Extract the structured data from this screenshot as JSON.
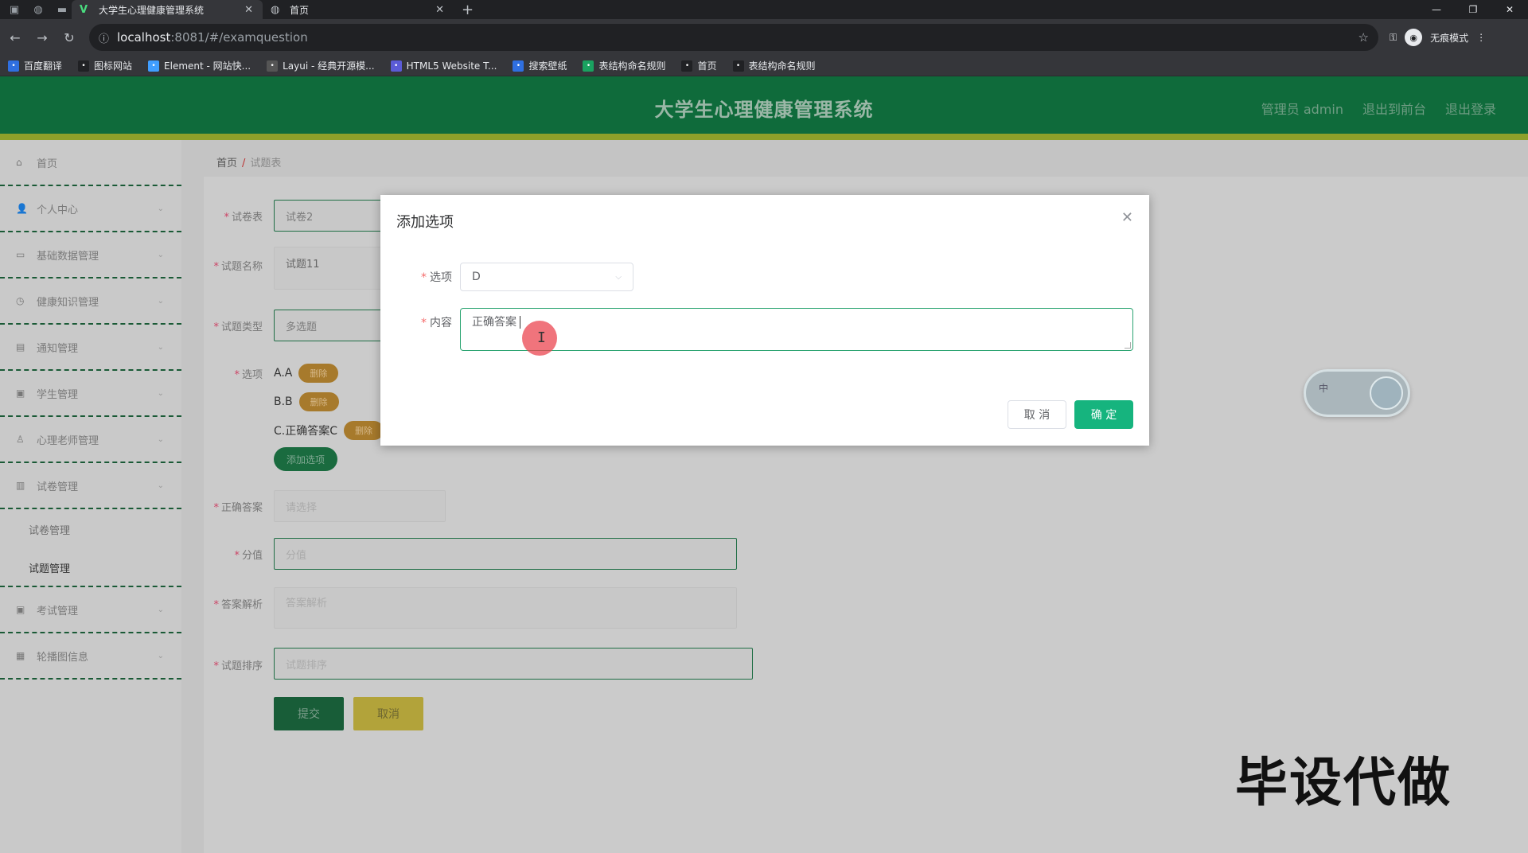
{
  "browser": {
    "tabs": [
      {
        "title": "大学生心理健康管理系统",
        "active": true
      },
      {
        "title": "首页",
        "active": false
      }
    ],
    "url_host": "localhost",
    "url_path": ":8081/#/examquestion",
    "incognito_label": "无痕模式",
    "bookmarks": [
      {
        "label": "百度翻译",
        "color": "#2f6fe0"
      },
      {
        "label": "图标网站",
        "color": "#202124"
      },
      {
        "label": "Element - 网站快...",
        "color": "#409eff"
      },
      {
        "label": "Layui - 经典开源模...",
        "color": "#555"
      },
      {
        "label": "HTML5 Website T...",
        "color": "#5b5bd6"
      },
      {
        "label": "搜索壁纸",
        "color": "#2f6fe0"
      },
      {
        "label": "表结构命名规则",
        "color": "#1aa260"
      },
      {
        "label": "首页",
        "color": "#202124"
      },
      {
        "label": "表结构命名规则",
        "color": "#202124"
      }
    ]
  },
  "header": {
    "title": "大学生心理健康管理系统",
    "admin_label": "管理员 admin",
    "to_front_label": "退出到前台",
    "logout_label": "退出登录"
  },
  "sidebar": {
    "items": [
      {
        "label": "首页",
        "icon": "home-icon"
      },
      {
        "label": "个人中心",
        "icon": "user-icon"
      },
      {
        "label": "基础数据管理",
        "icon": "chat-icon"
      },
      {
        "label": "健康知识管理",
        "icon": "clock-icon"
      },
      {
        "label": "通知管理",
        "icon": "bell-icon"
      },
      {
        "label": "学生管理",
        "icon": "monitor-icon"
      },
      {
        "label": "心理老师管理",
        "icon": "user-edit-icon"
      },
      {
        "label": "试卷管理",
        "icon": "lock-icon"
      }
    ],
    "sub_items": [
      "试卷管理",
      "试题管理"
    ],
    "items_after": [
      {
        "label": "考试管理",
        "icon": "monitor-icon"
      },
      {
        "label": "轮播图信息",
        "icon": "grid-icon"
      }
    ]
  },
  "breadcrumb": {
    "home": "首页",
    "current": "试题表"
  },
  "form": {
    "paper_label": "试卷表",
    "paper_value": "试卷2",
    "name_label": "试题名称",
    "name_value": "试题11",
    "type_label": "试题类型",
    "type_value": "多选题",
    "options_label": "选项",
    "options": [
      "A.A",
      "B.B",
      "C.正确答案C"
    ],
    "delete_label": "删除",
    "add_option_label": "添加选项",
    "answer_label": "正确答案",
    "answer_placeholder": "请选择",
    "score_label": "分值",
    "score_placeholder": "分值",
    "analysis_label": "答案解析",
    "analysis_placeholder": "答案解析",
    "sort_label": "试题排序",
    "sort_placeholder": "试题排序",
    "submit_label": "提交",
    "cancel_label": "取消"
  },
  "modal": {
    "title": "添加选项",
    "option_label": "选项",
    "option_value": "D",
    "content_label": "内容",
    "content_value": "正确答案",
    "cancel_label": "取 消",
    "ok_label": "确 定"
  },
  "toggle": {
    "label": "中"
  },
  "watermark": "毕设代做"
}
